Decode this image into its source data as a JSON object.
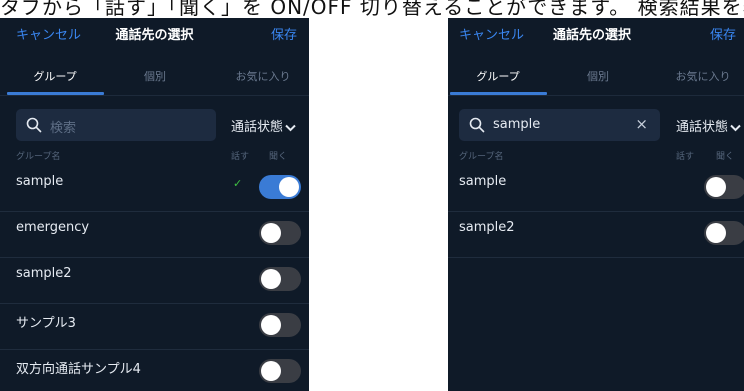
{
  "top_text": "タブから「話す」「聞く」を ON/OFF 切り替えることができます。 検索結果を表示しています。",
  "left": {
    "nav": {
      "cancel": "キャンセル",
      "title": "通話先の選択",
      "save": "保存"
    },
    "tabs": [
      "グループ",
      "個別",
      "お気に入り"
    ],
    "search": {
      "placeholder": "検索",
      "value": ""
    },
    "filter_label": "通話状態",
    "columns": {
      "name": "グループ名",
      "talk": "話す",
      "listen": "聞く"
    },
    "rows": [
      {
        "name": "sample",
        "talk_checked": true,
        "listen_on": true
      },
      {
        "name": "emergency",
        "talk_checked": false,
        "listen_on": false
      },
      {
        "name": "sample2",
        "talk_checked": false,
        "listen_on": false
      },
      {
        "name": "サンプル3",
        "talk_checked": false,
        "listen_on": false
      },
      {
        "name": "双方向通話サンプル4",
        "talk_checked": false,
        "listen_on": false
      }
    ],
    "check_glyph": "✓"
  },
  "right": {
    "nav": {
      "cancel": "キャンセル",
      "title": "通話先の選択",
      "save": "保存"
    },
    "tabs": [
      "グループ",
      "個別",
      "お気に入り"
    ],
    "search": {
      "placeholder": "検索",
      "value": "sample",
      "clear": "×"
    },
    "filter_label": "通話状態",
    "columns": {
      "name": "グループ名",
      "talk": "話す",
      "listen": "聞く"
    },
    "rows": [
      {
        "name": "sample",
        "listen_on": false
      },
      {
        "name": "sample2",
        "listen_on": false
      }
    ]
  },
  "colors": {
    "accent": "#3a86f0",
    "background": "#0f1a28",
    "check": "#3fc043",
    "toggle_off": "#3a3d44"
  }
}
